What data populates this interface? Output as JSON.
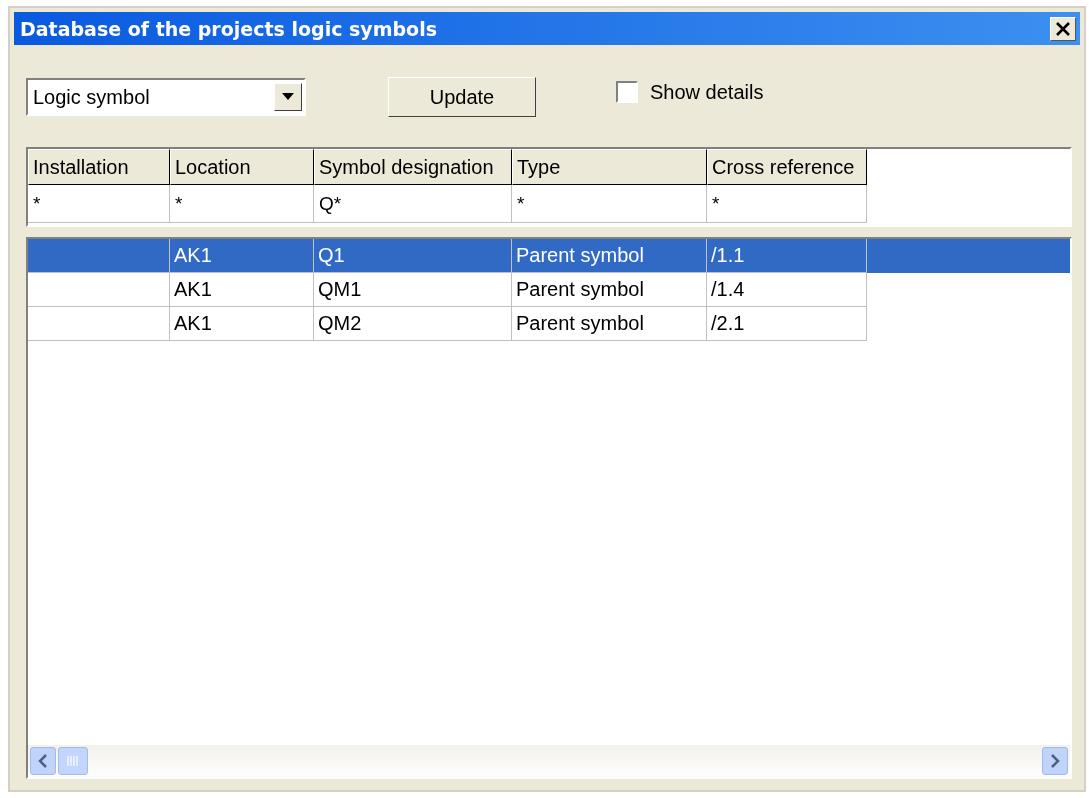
{
  "window": {
    "title": "Database of the projects logic symbols"
  },
  "symbol_type": {
    "value": "Logic symbol"
  },
  "update_button": "Update",
  "show_details": {
    "label": "Show details",
    "checked": false
  },
  "columns": [
    "Installation",
    "Location",
    "Symbol designation",
    "Type",
    "Cross reference"
  ],
  "filters": [
    "*",
    "*",
    "Q*",
    "*",
    "*"
  ],
  "rows": [
    {
      "cells": [
        "",
        "AK1",
        "Q1",
        "Parent symbol",
        "/1.1"
      ],
      "selected": true
    },
    {
      "cells": [
        "",
        "AK1",
        "QM1",
        "Parent symbol",
        "/1.4"
      ],
      "selected": false
    },
    {
      "cells": [
        "",
        "AK1",
        "QM2",
        "Parent symbol",
        "/2.1"
      ],
      "selected": false
    }
  ]
}
